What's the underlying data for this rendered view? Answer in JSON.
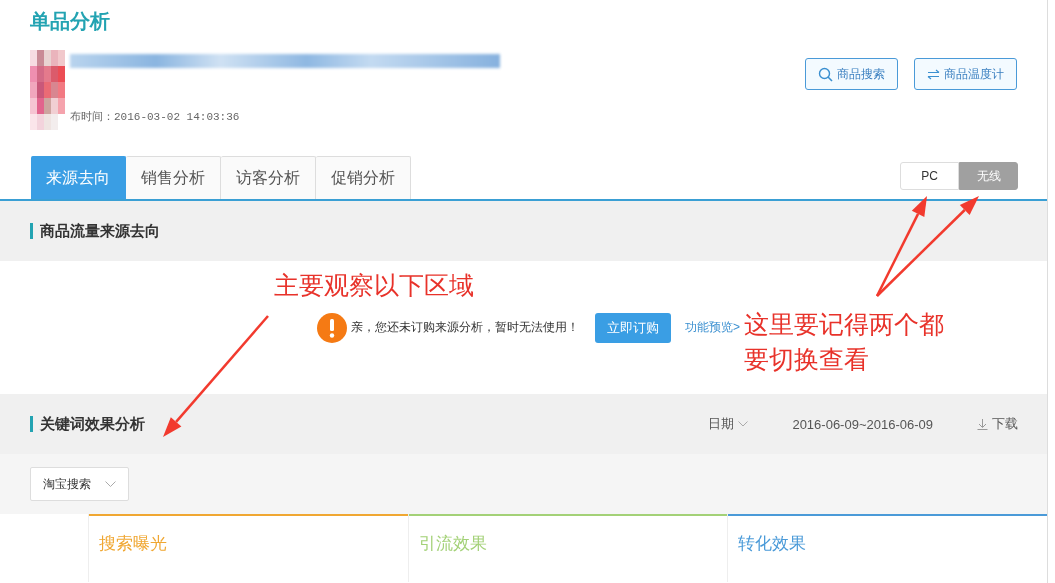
{
  "page_title": "单品分析",
  "product": {
    "publish_time": "布时间：2016-03-02 14:03:36"
  },
  "header_buttons": [
    {
      "label": "商品搜索",
      "kind": "search"
    },
    {
      "label": "商品温度计",
      "kind": "swap"
    }
  ],
  "tabs": [
    {
      "label": "来源去向",
      "selected": true
    },
    {
      "label": "销售分析",
      "selected": false
    },
    {
      "label": "访客分析",
      "selected": false
    },
    {
      "label": "促销分析",
      "selected": false
    }
  ],
  "device_toggle": [
    {
      "label": "PC",
      "selected": false
    },
    {
      "label": "无线",
      "selected": true
    }
  ],
  "source_section": {
    "title": "商品流量来源去向",
    "notice": {
      "message": "亲，您还未订购来源分析，暂时无法使用！",
      "subscribe_button": "立即订购",
      "preview_link": "功能预览>"
    }
  },
  "keyword_section": {
    "title": "关键词效果分析",
    "date_label": "日期",
    "date_range": "2016-06-09~2016-06-09",
    "download": "下载",
    "channel_select": "淘宝搜索",
    "cards": [
      {
        "title": "搜索曝光",
        "color": "#f0a732"
      },
      {
        "title": "引流效果",
        "color": "#a3d177"
      },
      {
        "title": "转化效果",
        "color": "#4a9ad8"
      }
    ]
  },
  "annotations": [
    {
      "text": "主要观察以下区域"
    },
    {
      "text": "这里要记得两个都要切换查看"
    }
  ]
}
